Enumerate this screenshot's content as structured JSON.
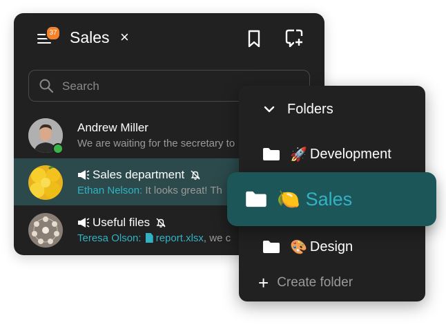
{
  "header": {
    "title": "Sales",
    "close_glyph": "×",
    "unread_badge": "37"
  },
  "search": {
    "placeholder": "Search"
  },
  "chats": [
    {
      "name": "Andrew Miller",
      "message": "We are waiting for the secretary to",
      "online": true
    },
    {
      "name": "Sales department",
      "sender": "Ethan Nelson:",
      "message": "It looks great! Th",
      "muted": true,
      "type": "channel"
    },
    {
      "name": "Useful files",
      "sender": "Teresa Olson:",
      "file_name": "report.xlsx",
      "message": ", we c",
      "muted": true,
      "type": "channel"
    }
  ],
  "folders_panel": {
    "heading": "Folders",
    "items": [
      {
        "emoji": "🚀",
        "label": "Development"
      },
      {
        "emoji": "🍋",
        "label": "Sales",
        "selected": true
      },
      {
        "emoji": "🎨",
        "label": "Design"
      }
    ],
    "create_label": "Create folder"
  },
  "colors": {
    "accent": "#2fb3c4",
    "badge": "#f5822a",
    "selected_folder": "#1d5659",
    "window": "#212121",
    "online": "#3bb54a"
  }
}
